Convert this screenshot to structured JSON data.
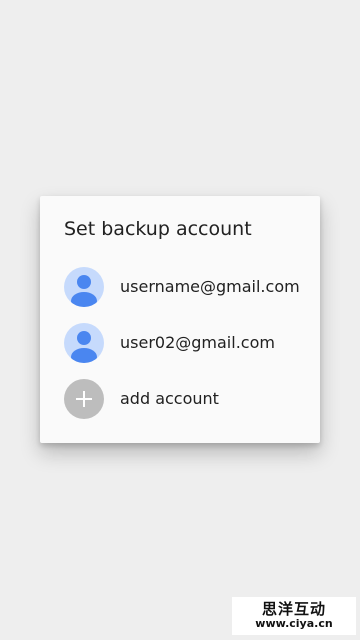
{
  "dialog": {
    "title": "Set backup account",
    "accounts": [
      {
        "email": "username@gmail.com",
        "icon": "account-avatar-icon"
      },
      {
        "email": "user02@gmail.com",
        "icon": "account-avatar-icon"
      }
    ],
    "add_account": {
      "label": "add account",
      "icon": "add-icon"
    }
  },
  "watermark": {
    "name": "思洋互动",
    "url": "www.ciya.cn"
  },
  "colors": {
    "background": "#eeeeee",
    "dialog": "#fafafa",
    "avatar_bg": "#c6dafc",
    "avatar_fg": "#4a86f0",
    "add_bg": "#bdbdbd"
  }
}
